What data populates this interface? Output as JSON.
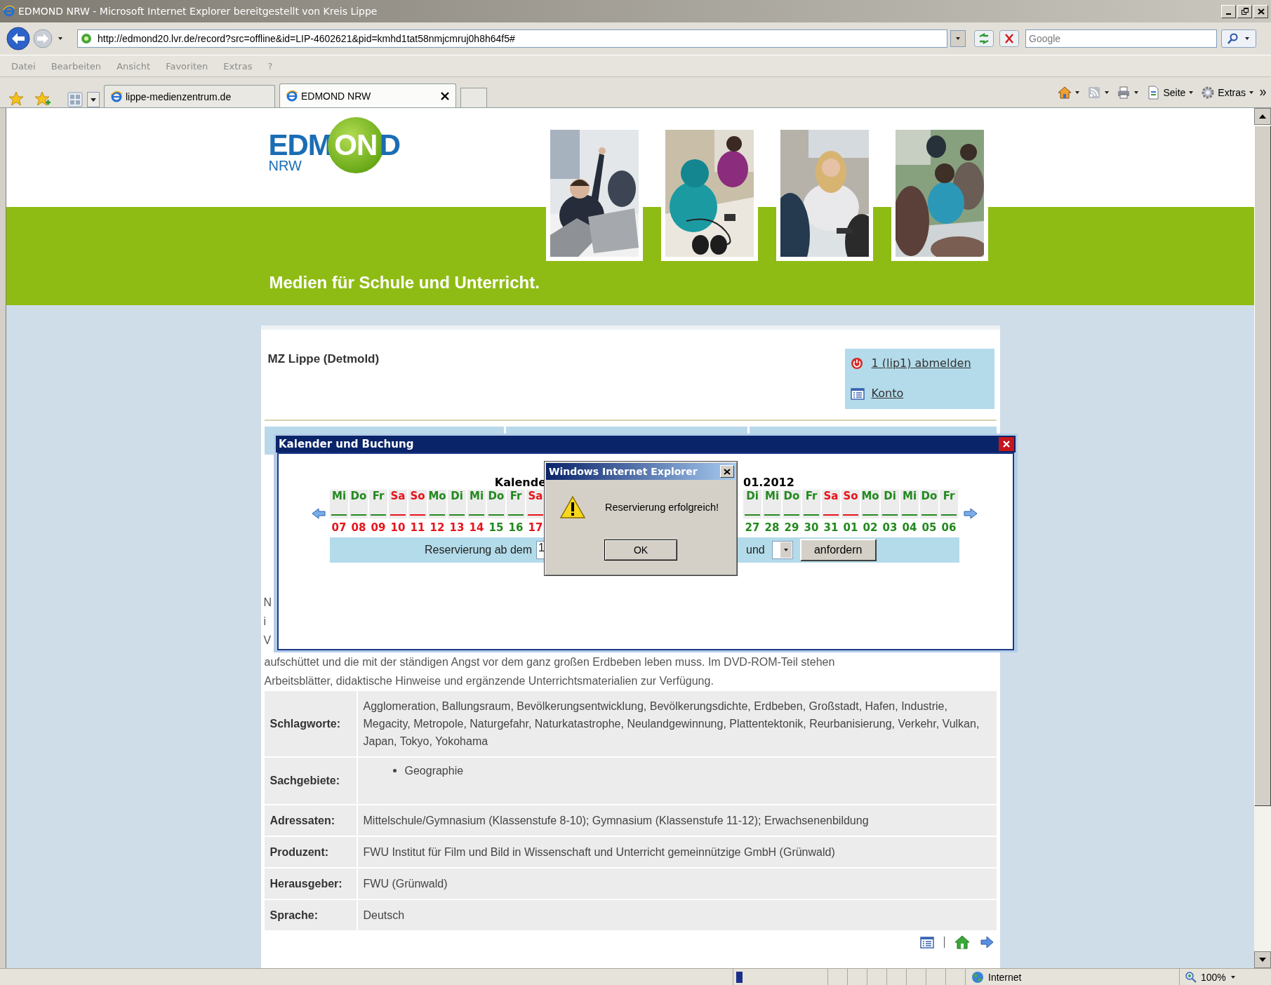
{
  "window": {
    "title": "EDMOND NRW - Microsoft Internet Explorer bereitgestellt von Kreis Lippe"
  },
  "address_bar": {
    "url": "http://edmond20.lvr.de/record?src=offline&id=LIP-4602621&pid=kmhd1tat58nmjcmruj0h8h64f5#",
    "search_placeholder": "Google"
  },
  "menu": [
    "Datei",
    "Bearbeiten",
    "Ansicht",
    "Favoriten",
    "Extras",
    "?"
  ],
  "tabs": [
    {
      "label": "lippe-medienzentrum.de",
      "selected": false
    },
    {
      "label": "EDMOND NRW",
      "selected": true
    }
  ],
  "command_bar": [
    {
      "kind": "home"
    },
    {
      "kind": "feed"
    },
    {
      "kind": "print"
    },
    {
      "kind": "page",
      "label": "Seite"
    },
    {
      "kind": "tools",
      "label": "Extras"
    }
  ],
  "page": {
    "logo": {
      "parts": [
        "EDM",
        "ON",
        "D"
      ],
      "subtitle": "NRW"
    },
    "tagline": "Medien für Schule und Unterricht.",
    "institution": "MZ Lippe (Detmold)",
    "account_links": [
      {
        "label": "1 (lip1) abmelden",
        "kind": "logout"
      },
      {
        "label": "Konto",
        "kind": "account"
      }
    ],
    "hidden_line_starts": [
      "N",
      "i",
      "V"
    ],
    "description": [
      "aufschüttet und die mit der ständigen Angst vor dem ganz großen Erdbeben leben muss. Im DVD-ROM-Teil stehen",
      "Arbeitsblätter, didaktische Hinweise und ergänzende Unterrichtsmaterialien zur Verfügung."
    ],
    "details": [
      {
        "label": "Schlagworte:",
        "kind": "text",
        "value": "Agglomeration, Ballungsraum, Bevölkerungsentwicklung, Bevölkerungsdichte, Erdbeben, Großstadt, Hafen, Industrie, Megacity, Metropole, Naturgefahr, Naturkatastrophe, Neulandgewinnung, Plattentektonik, Reurbanisierung, Verkehr, Vulkan, Japan, Tokyo, Yokohama"
      },
      {
        "label": "Sachgebiete:",
        "kind": "list",
        "items": [
          "Geographie"
        ]
      },
      {
        "label": "Adressaten:",
        "kind": "text",
        "value": "Mittelschule/Gymnasium (Klassenstufe 8-10); Gymnasium (Klassenstufe 11-12); Erwachsenenbildung"
      },
      {
        "label": "Produzent:",
        "kind": "text",
        "value": "FWU Institut für Film und Bild in Wissenschaft und Unterricht gemeinnützige GmbH (Grünwald)"
      },
      {
        "label": "Herausgeber:",
        "kind": "text",
        "value": "FWU (Grünwald)"
      },
      {
        "label": "Sprache:",
        "kind": "text",
        "value": "Deutsch"
      }
    ]
  },
  "calendar_dialog": {
    "title": "Kalender und Buchung",
    "heading_parts": [
      "Kalende",
      "01.2012"
    ],
    "days_before": [
      {
        "day": "Mi",
        "weekend": false,
        "date": "07",
        "booked": true
      },
      {
        "day": "Do",
        "weekend": false,
        "date": "08",
        "booked": true
      },
      {
        "day": "Fr",
        "weekend": false,
        "date": "09",
        "booked": true
      },
      {
        "day": "Sa",
        "weekend": true,
        "date": "10",
        "booked": true
      },
      {
        "day": "So",
        "weekend": true,
        "date": "11",
        "booked": true
      },
      {
        "day": "Mo",
        "weekend": false,
        "date": "12",
        "booked": true
      },
      {
        "day": "Di",
        "weekend": false,
        "date": "13",
        "booked": true
      },
      {
        "day": "Mi",
        "weekend": false,
        "date": "14",
        "booked": true
      },
      {
        "day": "Do",
        "weekend": false,
        "date": "15",
        "booked": false
      },
      {
        "day": "Fr",
        "weekend": false,
        "date": "16",
        "booked": false
      },
      {
        "day": "Sa",
        "weekend": true,
        "date": "17",
        "booked": true
      }
    ],
    "days_after": [
      {
        "day": "Di",
        "weekend": false,
        "date": "27",
        "booked": false
      },
      {
        "day": "Mi",
        "weekend": false,
        "date": "28",
        "booked": false
      },
      {
        "day": "Do",
        "weekend": false,
        "date": "29",
        "booked": false
      },
      {
        "day": "Fr",
        "weekend": false,
        "date": "30",
        "booked": false
      },
      {
        "day": "Sa",
        "weekend": true,
        "date": "31",
        "booked": false
      },
      {
        "day": "So",
        "weekend": true,
        "date": "01",
        "booked": false
      },
      {
        "day": "Mo",
        "weekend": false,
        "date": "02",
        "booked": false
      },
      {
        "day": "Di",
        "weekend": false,
        "date": "03",
        "booked": false
      },
      {
        "day": "Mi",
        "weekend": false,
        "date": "04",
        "booked": false
      },
      {
        "day": "Do",
        "weekend": false,
        "date": "05",
        "booked": false
      },
      {
        "day": "Fr",
        "weekend": false,
        "date": "06",
        "booked": false
      }
    ],
    "reservation_label": "Reservierung ab dem",
    "date_value": "1",
    "and_label": "und",
    "request_button": "anfordern"
  },
  "alert": {
    "title": "Windows Internet Explorer",
    "message": "Reservierung erfolgreich!",
    "button": "OK"
  },
  "status_bar": {
    "progress": {
      "level": 0.07
    },
    "zone": "Internet",
    "zoom": "100%"
  }
}
